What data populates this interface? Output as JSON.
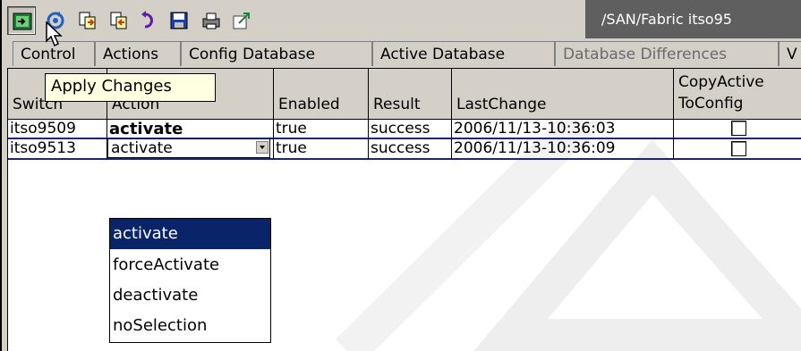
{
  "toolbar": {
    "buttons": [
      {
        "name": "apply-changes",
        "icon": "apply-icon",
        "pressed": true
      },
      {
        "name": "refresh",
        "icon": "refresh-icon"
      },
      {
        "name": "copy-active-to-config",
        "icon": "copy-active-icon"
      },
      {
        "name": "copy-config",
        "icon": "copy-config-icon"
      },
      {
        "name": "undo",
        "icon": "undo-icon"
      },
      {
        "name": "save",
        "icon": "save-icon"
      },
      {
        "name": "print",
        "icon": "print-icon"
      },
      {
        "name": "export",
        "icon": "export-icon"
      }
    ],
    "path": "/SAN/Fabric itso95"
  },
  "tabs": [
    "Control",
    "Actions",
    "Config Database",
    "Active Database",
    "Database Differences",
    "V"
  ],
  "tooltip": "Apply Changes",
  "table": {
    "headers": [
      {
        "line1": "",
        "line2": "Switch"
      },
      {
        "line1": "",
        "line2": "Action"
      },
      {
        "line1": "",
        "line2": "Enabled"
      },
      {
        "line1": "",
        "line2": "Result"
      },
      {
        "line1": "",
        "line2": "LastChange"
      },
      {
        "line1": "CopyActive",
        "line2": "ToConfig"
      }
    ],
    "rows": [
      {
        "switch": "itso9509",
        "action": "activate",
        "enabled": "true",
        "result": "success",
        "last_change": "2006/11/13-10:36:03",
        "copy": false
      },
      {
        "switch": "itso9513",
        "action": "activate",
        "enabled": "true",
        "result": "success",
        "last_change": "2006/11/13-10:36:09",
        "copy": false
      }
    ]
  },
  "dropdown": {
    "selected": "activate",
    "options": [
      "activate",
      "forceActivate",
      "deactivate",
      "noSelection"
    ]
  },
  "colors": {
    "window": "#d4d0c8",
    "path_bar": "#5f5f5f",
    "selection": "#0a246a",
    "tooltip": "#ffffe1"
  }
}
